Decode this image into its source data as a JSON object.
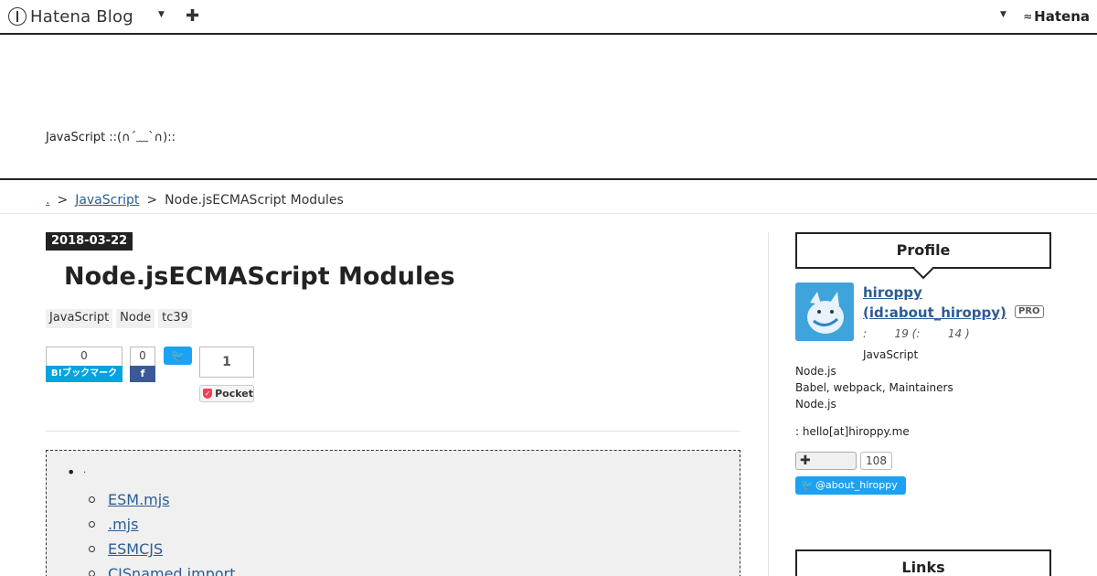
{
  "globalbar": {
    "logo_text": "Hatena Blog",
    "add_label": "✚",
    "hatena_text": "Hatena"
  },
  "blog": {
    "description": "JavaScript ::(∩´﹏`∩)::"
  },
  "breadcrumb": {
    "home": ".",
    "separator": ">",
    "category": "JavaScript",
    "current": "Node.jsECMAScript Modules"
  },
  "entry": {
    "date": "2018-03-22",
    "title": "Node.jsECMAScript Modules",
    "tags": [
      "JavaScript",
      "Node",
      "tc39"
    ],
    "hatena_bookmark_count": "0",
    "hatena_bookmark_label": "B!ブックマーク",
    "facebook_count": "0",
    "facebook_label": "f",
    "twitter_label": "🐦",
    "pocket_count": "1",
    "pocket_label": "Pocket"
  },
  "toc": {
    "top_item": ".",
    "items": [
      "ESM.mjs",
      ".mjs",
      "ESMCJS",
      "CJSnamed import"
    ]
  },
  "sidebar": {
    "profile_title": "Profile",
    "profile_name": "hiroppy (id:about_hiroppy)",
    "pro_badge": "PRO",
    "age_line": ":        19 (:        14 )",
    "lines": [
      "JavaScript",
      "Node.js",
      "Babel, webpack, Maintainers",
      "Node.js",
      ": hello[at]hiroppy.me"
    ],
    "follow_label": "✚",
    "follow_count": "108",
    "twitter_handle": "@about_hiroppy",
    "links_title": "Links"
  }
}
